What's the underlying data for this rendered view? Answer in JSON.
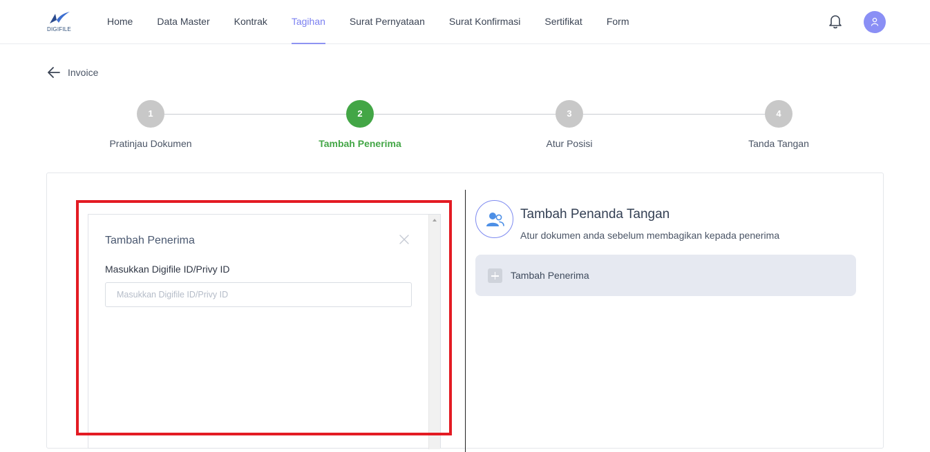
{
  "brand": {
    "logo_text": "DIGIFILE",
    "accent": "#8e93f2"
  },
  "nav": {
    "items": [
      {
        "label": "Home",
        "active": false
      },
      {
        "label": "Data Master",
        "active": false
      },
      {
        "label": "Kontrak",
        "active": false
      },
      {
        "label": "Tagihan",
        "active": true
      },
      {
        "label": "Surat Pernyataan",
        "active": false
      },
      {
        "label": "Surat Konfirmasi",
        "active": false
      },
      {
        "label": "Sertifikat",
        "active": false
      },
      {
        "label": "Form",
        "active": false
      }
    ],
    "icons": {
      "notification": "bell-icon",
      "profile": "user-icon"
    }
  },
  "breadcrumb": {
    "back_label": "Invoice"
  },
  "steps": [
    {
      "number": "1",
      "label": "Pratinjau Dokumen",
      "active": false
    },
    {
      "number": "2",
      "label": "Tambah Penerima",
      "active": true
    },
    {
      "number": "3",
      "label": "Atur Posisi",
      "active": false
    },
    {
      "number": "4",
      "label": "Tanda Tangan",
      "active": false
    }
  ],
  "modal": {
    "title": "Tambah Penerima",
    "field_label": "Masukkan Digifile ID/Privy ID",
    "field_value": "",
    "field_placeholder": "Masukkan Digifile ID/Privy ID"
  },
  "signer": {
    "title": "Tambah Penanda Tangan",
    "subtitle": "Atur dokumen anda sebelum membagikan kepada penerima",
    "add_label": "Tambah Penerima"
  },
  "colors": {
    "step_active": "#43a646",
    "step_inactive": "#c8c8c8",
    "highlight": "#e31b23"
  }
}
